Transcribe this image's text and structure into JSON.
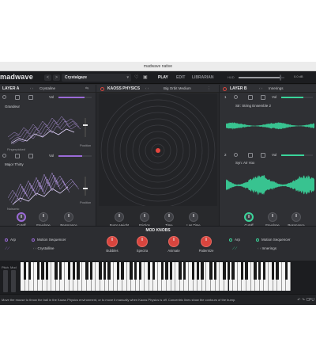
{
  "window": {
    "title": "madwave native"
  },
  "topbar": {
    "logo": "madwave",
    "nav_back": "<",
    "nav_forward": ">",
    "preset": "Crystalgaze",
    "preset_caret": "▾",
    "heart_icon": "heart-icon",
    "tabs": [
      "PLAY",
      "EDIT",
      "LIBRARIAN"
    ],
    "active_tab": "PLAY",
    "hud_label": "HUD",
    "volume_readout": "0.0 dB",
    "volume_level": 0.9
  },
  "layer_a": {
    "title": "LAYER A",
    "preset": "Crystaline",
    "accent": "#9b6ad8",
    "slots": [
      {
        "vol_label": "Vol",
        "vol_level": 0.78,
        "name": "Grandeur",
        "sub": "Fingerpicked",
        "pos_label": "Position"
      },
      {
        "vol_label": "Vol",
        "vol_level": 0.72,
        "name": "Major Thirty",
        "sub": "Noisonic",
        "pos_label": "Position"
      }
    ],
    "knobs": [
      "Cutoff",
      "Envelope",
      "Resonance"
    ]
  },
  "kaoss": {
    "title": "KAOSS PHYSICS",
    "preset": "Big Orbit Medium",
    "knobs": [
      "Bump Height",
      "Friction",
      "Time",
      "Lag Time"
    ]
  },
  "layer_b": {
    "title": "LAYER B",
    "preset": "Innerings",
    "accent": "#3ad49a",
    "slots": [
      {
        "vol_label": "Vol",
        "vol_level": 0.7,
        "name": "Str: String Ensemble 2"
      },
      {
        "vol_label": "Vol",
        "vol_level": 0.72,
        "name": "Syn: Air Vox"
      }
    ],
    "knobs": [
      "Cutoff",
      "Envelope",
      "Resonance"
    ]
  },
  "mod_knobs": {
    "title": "MOD KNOBS",
    "left": {
      "arp": "Arp",
      "seq": "Motion Sequencer",
      "seq_preset": "Crystalline"
    },
    "right": {
      "arp": "Arp",
      "seq": "Motion Sequencer",
      "seq_preset": "Innerings"
    },
    "knobs": [
      "Bubbles",
      "Spectra",
      "Animate",
      "Patternize"
    ]
  },
  "keyboard": {
    "pitch_label": "Pitch",
    "mod_label": "Mod"
  },
  "status": {
    "text": "Move the mouse to throw the ball in the Kaoss Physics environment, or to move it manually when Kaoss Physics is off. Concentric lines show the contours of the bump.",
    "cpu_label": "CPU"
  }
}
